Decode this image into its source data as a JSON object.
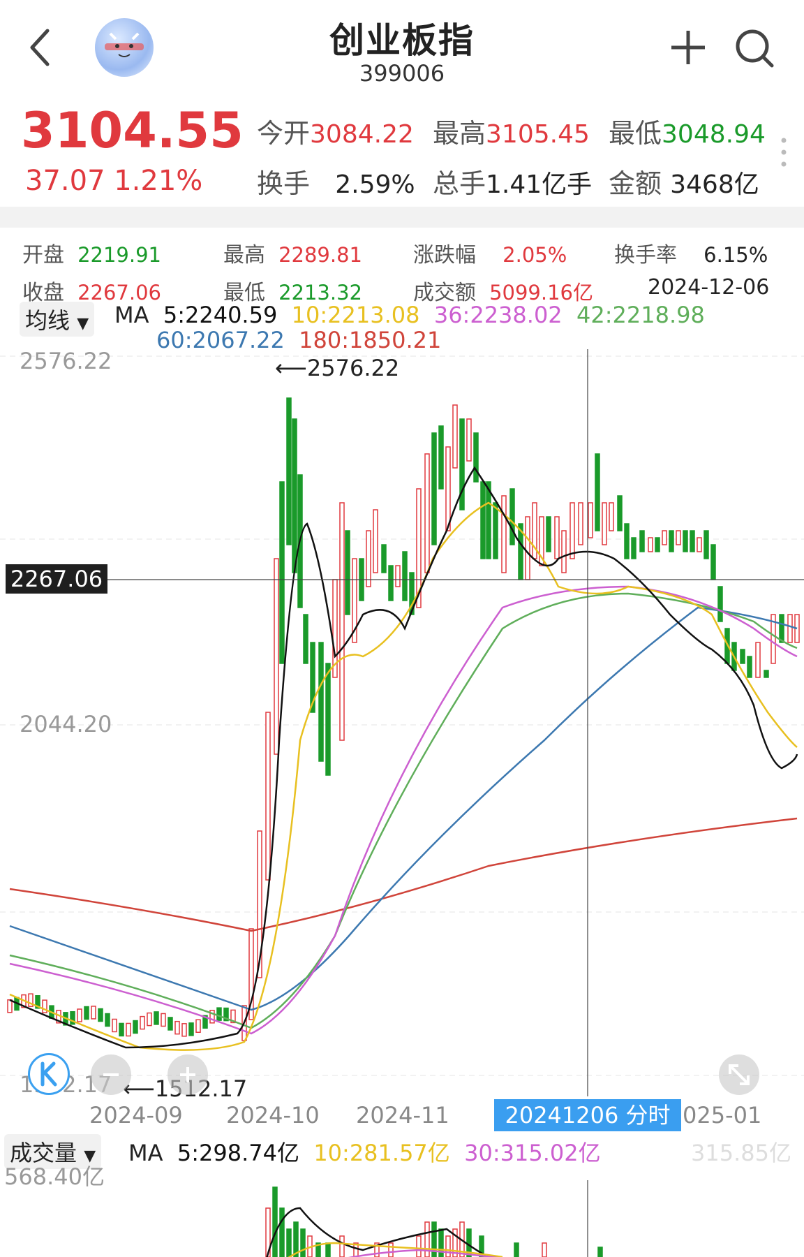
{
  "header": {
    "title": "创业板指",
    "code": "399006"
  },
  "quote": {
    "price": "3104.55",
    "change": "37.07",
    "change_pct": "1.21%",
    "open_label": "今开",
    "open": "3084.22",
    "high_label": "最高",
    "high": "3105.45",
    "low_label": "最低",
    "low": "3048.94",
    "turnover_label": "换手",
    "turnover": "2.59%",
    "total_vol_label": "总手",
    "total_vol": "1.41亿手",
    "amount_label": "金额",
    "amount": "3468亿"
  },
  "candle_info": {
    "open_label": "开盘",
    "open": "2219.91",
    "high_label": "最高",
    "high": "2289.81",
    "chg_label": "涨跌幅",
    "chg": "2.05%",
    "turn_label": "换手率",
    "turn": "6.15%",
    "close_label": "收盘",
    "close": "2267.06",
    "low_label": "最低",
    "low": "2213.32",
    "amount_label": "成交额",
    "amount": "5099.16亿",
    "date": "2024-12-06"
  },
  "indicator": {
    "selector": "均线",
    "ma_label": "MA",
    "ma5": "5:2240.59",
    "ma10": "10:2213.08",
    "ma36": "36:2238.02",
    "ma42": "42:2218.98",
    "ma60": "60:2067.22",
    "ma180": "180:1850.21"
  },
  "chart": {
    "y_top": "2576.22",
    "y_mid": "2044.20",
    "y_bottom": "1512.17",
    "max_marker": "2576.22",
    "min_marker": "1512.17",
    "crosshair_price": "2267.06",
    "x_labels": [
      "2024-09",
      "2024-10",
      "2024-11",
      "025-01"
    ],
    "crosshair_date": "20241206 分时 >"
  },
  "volume": {
    "selector": "成交量",
    "ma_label": "MA",
    "ma5": "5:298.74亿",
    "ma10": "10:281.57亿",
    "ma30": "30:315.02亿",
    "right_value": "315.85亿",
    "y_top": "568.40亿"
  },
  "colors": {
    "up": "#e0393e",
    "down": "#1a9a2a",
    "ma5": "#111111",
    "ma10": "#e8c020",
    "ma36": "#cc5fd0",
    "ma42": "#5fae5a",
    "ma60": "#3c78b0",
    "ma180": "#d0443a"
  }
}
